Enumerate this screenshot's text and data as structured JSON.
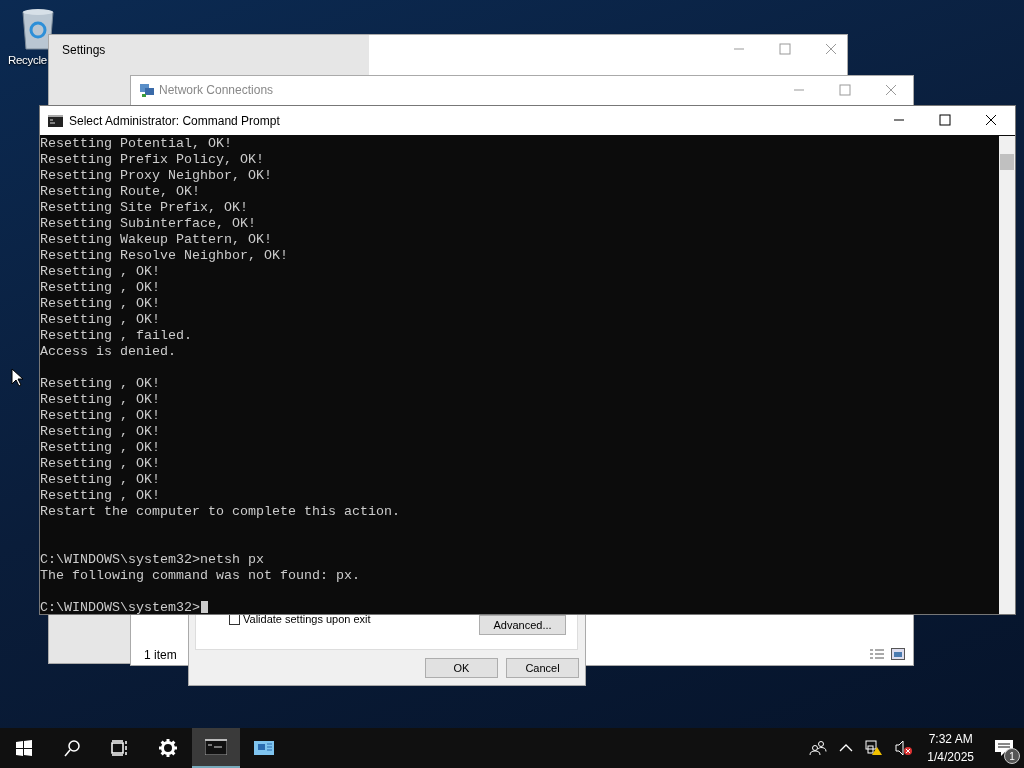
{
  "desktop_icons": [
    {
      "label": "Recycle"
    }
  ],
  "settings_window": {
    "title": "Settings"
  },
  "network_window": {
    "title": "Network Connections",
    "status": "1 item"
  },
  "dialog": {
    "checkbox": {
      "label": "Validate settings upon exit",
      "checked": false
    },
    "advanced_button": "Advanced...",
    "buttons": [
      "OK",
      "Cancel"
    ]
  },
  "console_window": {
    "title": "Select Administrator: Command Prompt",
    "lines": [
      {
        "kind": "text",
        "text": "Resetting Potential, OK!"
      },
      {
        "kind": "text",
        "text": "Resetting Prefix Policy, OK!"
      },
      {
        "kind": "text",
        "text": "Resetting Proxy Neighbor, OK!"
      },
      {
        "kind": "text",
        "text": "Resetting Route, OK!"
      },
      {
        "kind": "text",
        "text": "Resetting Site Prefix, OK!"
      },
      {
        "kind": "text",
        "text": "Resetting Subinterface, OK!"
      },
      {
        "kind": "text",
        "text": "Resetting Wakeup Pattern, OK!"
      },
      {
        "kind": "text",
        "text": "Resetting Resolve Neighbor, OK!"
      },
      {
        "kind": "text",
        "text": "Resetting , OK!"
      },
      {
        "kind": "text",
        "text": "Resetting , OK!"
      },
      {
        "kind": "text",
        "text": "Resetting , OK!"
      },
      {
        "kind": "text",
        "text": "Resetting , OK!"
      },
      {
        "kind": "text",
        "text": "Resetting , failed."
      },
      {
        "kind": "text",
        "text": "Access is denied."
      },
      {
        "kind": "blank"
      },
      {
        "kind": "text",
        "text": "Resetting , OK!"
      },
      {
        "kind": "text",
        "text": "Resetting , OK!"
      },
      {
        "kind": "text",
        "text": "Resetting , OK!"
      },
      {
        "kind": "text",
        "text": "Resetting , OK!"
      },
      {
        "kind": "text",
        "text": "Resetting , OK!"
      },
      {
        "kind": "text",
        "text": "Resetting , OK!"
      },
      {
        "kind": "text",
        "text": "Resetting , OK!"
      },
      {
        "kind": "text",
        "text": "Resetting , OK!"
      },
      {
        "kind": "text",
        "text": "Restart the computer to complete this action."
      },
      {
        "kind": "blank"
      },
      {
        "kind": "blank"
      },
      {
        "kind": "text",
        "text": "C:\\WINDOWS\\system32>netsh px"
      },
      {
        "kind": "text",
        "text": "The following command was not found: px."
      },
      {
        "kind": "blank"
      }
    ],
    "prompt": "C:\\WINDOWS\\system32>"
  },
  "taskbar": {
    "time": "7:32 AM",
    "date": "1/4/2025",
    "notification_count": "1"
  }
}
